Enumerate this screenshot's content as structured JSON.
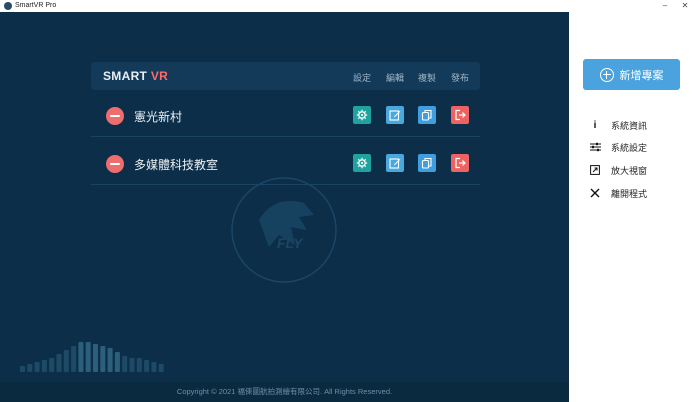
{
  "window": {
    "title": "SmartVR Pro",
    "minimize": "–",
    "close": "✕"
  },
  "header": {
    "brand_main": "SMART",
    "brand_accent": "VR",
    "links": [
      "設定",
      "編輯",
      "複製",
      "發布"
    ]
  },
  "projects": [
    {
      "name": "憲光新村"
    },
    {
      "name": "多媒體科技教室"
    }
  ],
  "footer": {
    "copyright": "Copyright © 2021 福倈圖航拍測繪有限公司. All Rights Reserved."
  },
  "sidebar": {
    "new_project": "新增專案",
    "menu": [
      {
        "label": "系統資訊",
        "icon": "info-icon"
      },
      {
        "label": "系統設定",
        "icon": "sliders-icon"
      },
      {
        "label": "放大視窗",
        "icon": "expand-icon"
      },
      {
        "label": "離開程式",
        "icon": "close-icon"
      }
    ]
  },
  "colors": {
    "panel": "#0d2e48",
    "accent": "#4aa3df",
    "danger": "#ee6e6e",
    "teal": "#1ea3a0"
  }
}
